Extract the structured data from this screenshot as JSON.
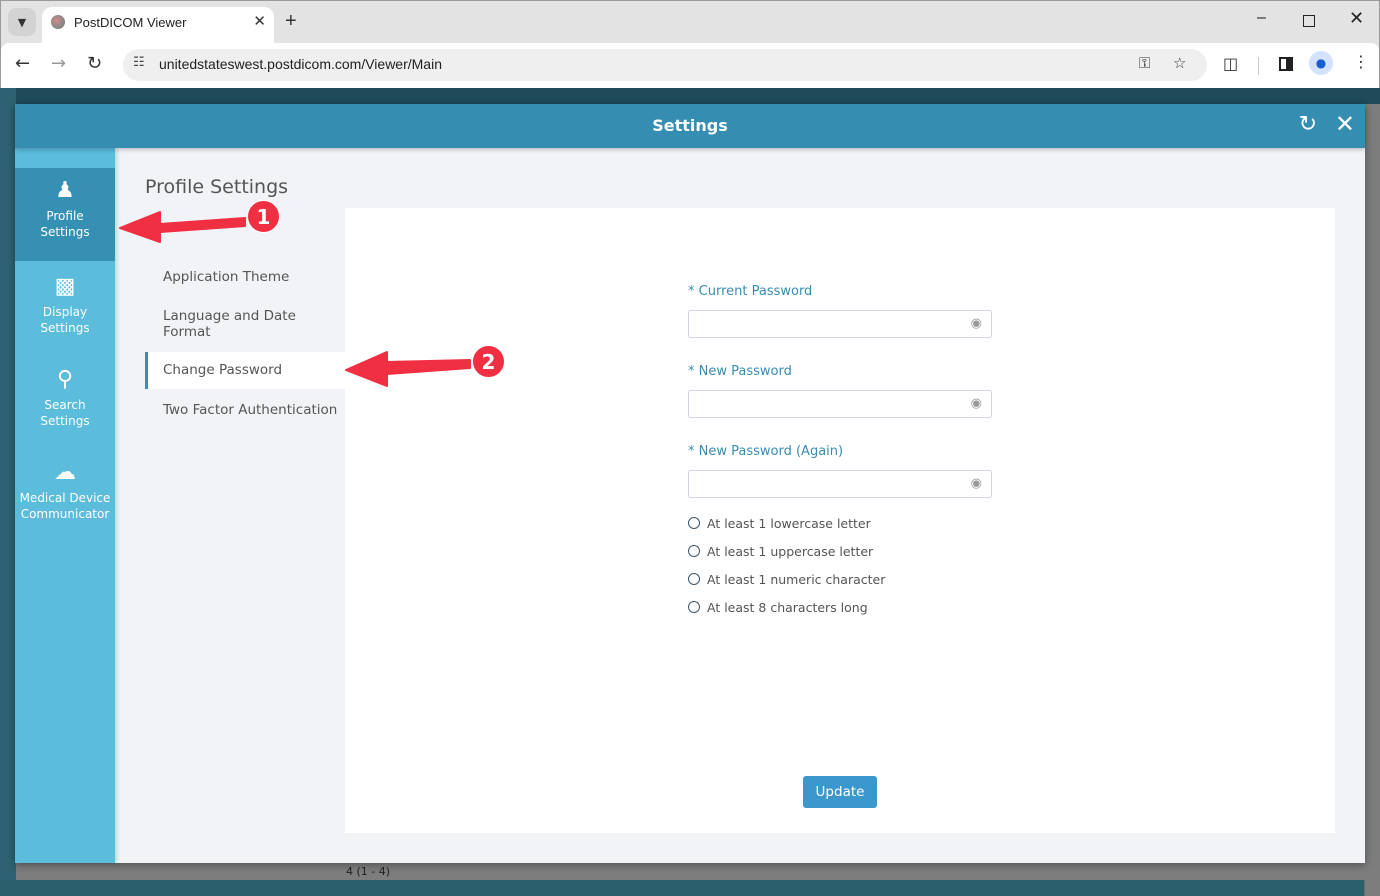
{
  "browser": {
    "tab_title": "PostDICOM Viewer",
    "new_tab": "+",
    "url": "unitedstateswest.postdicom.com/Viewer/Main",
    "icons": {
      "tab_menu": "chevron-down-icon",
      "back": "arrow-left-icon",
      "forward": "arrow-right-icon",
      "reload": "reload-icon",
      "site_info": "tune-icon",
      "password_key": "key-icon",
      "bookmark": "star-icon",
      "extensions": "puzzle-icon",
      "side_panel": "side-panel-icon",
      "profile": "profile-icon",
      "menu": "kebab-menu-icon"
    }
  },
  "background_app": {
    "bottom_text": "4 (1 - 4)"
  },
  "modal": {
    "title": "Settings",
    "reset_icon": "reset-icon",
    "close_icon": "close-icon"
  },
  "side_nav": {
    "items": [
      {
        "label_line1": "Profile",
        "label_line2": "Settings",
        "icon": "person-icon",
        "active": true
      },
      {
        "label_line1": "Display",
        "label_line2": "Settings",
        "icon": "monitor-gear-icon",
        "active": false
      },
      {
        "label_line1": "Search",
        "label_line2": "Settings",
        "icon": "search-gear-icon",
        "active": false
      },
      {
        "label_line1": "Medical Device",
        "label_line2": "Communicator",
        "icon": "cloud-upload-icon",
        "active": false
      }
    ]
  },
  "profile_settings": {
    "title": "Profile Settings",
    "sub_items": [
      {
        "label": "Application Theme",
        "active": false
      },
      {
        "label_line1": "Language and Date",
        "label_line2": "Format",
        "active": false
      },
      {
        "label": "Change Password",
        "active": true
      },
      {
        "label": "Two Factor Authentication",
        "active": false
      }
    ]
  },
  "change_password": {
    "fields": [
      {
        "label": "* Current Password",
        "value": "",
        "placeholder": ""
      },
      {
        "label": "* New Password",
        "value": "",
        "placeholder": ""
      },
      {
        "label": "* New Password (Again)",
        "value": "",
        "placeholder": ""
      }
    ],
    "rules": [
      {
        "text": "At least 1 lowercase letter",
        "satisfied": false
      },
      {
        "text": "At least 1 uppercase letter",
        "satisfied": false
      },
      {
        "text": "At least 1 numeric character",
        "satisfied": false
      },
      {
        "text": "At least 8 characters long",
        "satisfied": false
      }
    ],
    "update_label": "Update"
  },
  "annotations": [
    {
      "number": "1",
      "points_to": "Profile Settings"
    },
    {
      "number": "2",
      "points_to": "Change Password"
    }
  ],
  "colors": {
    "header_blue": "#368db2",
    "side_nav_blue": "#5bbcdc",
    "side_nav_active": "#3590b4",
    "label_blue": "#3a8cb0",
    "button_blue": "#3c97cd",
    "annotation_red": "#f02f42"
  }
}
